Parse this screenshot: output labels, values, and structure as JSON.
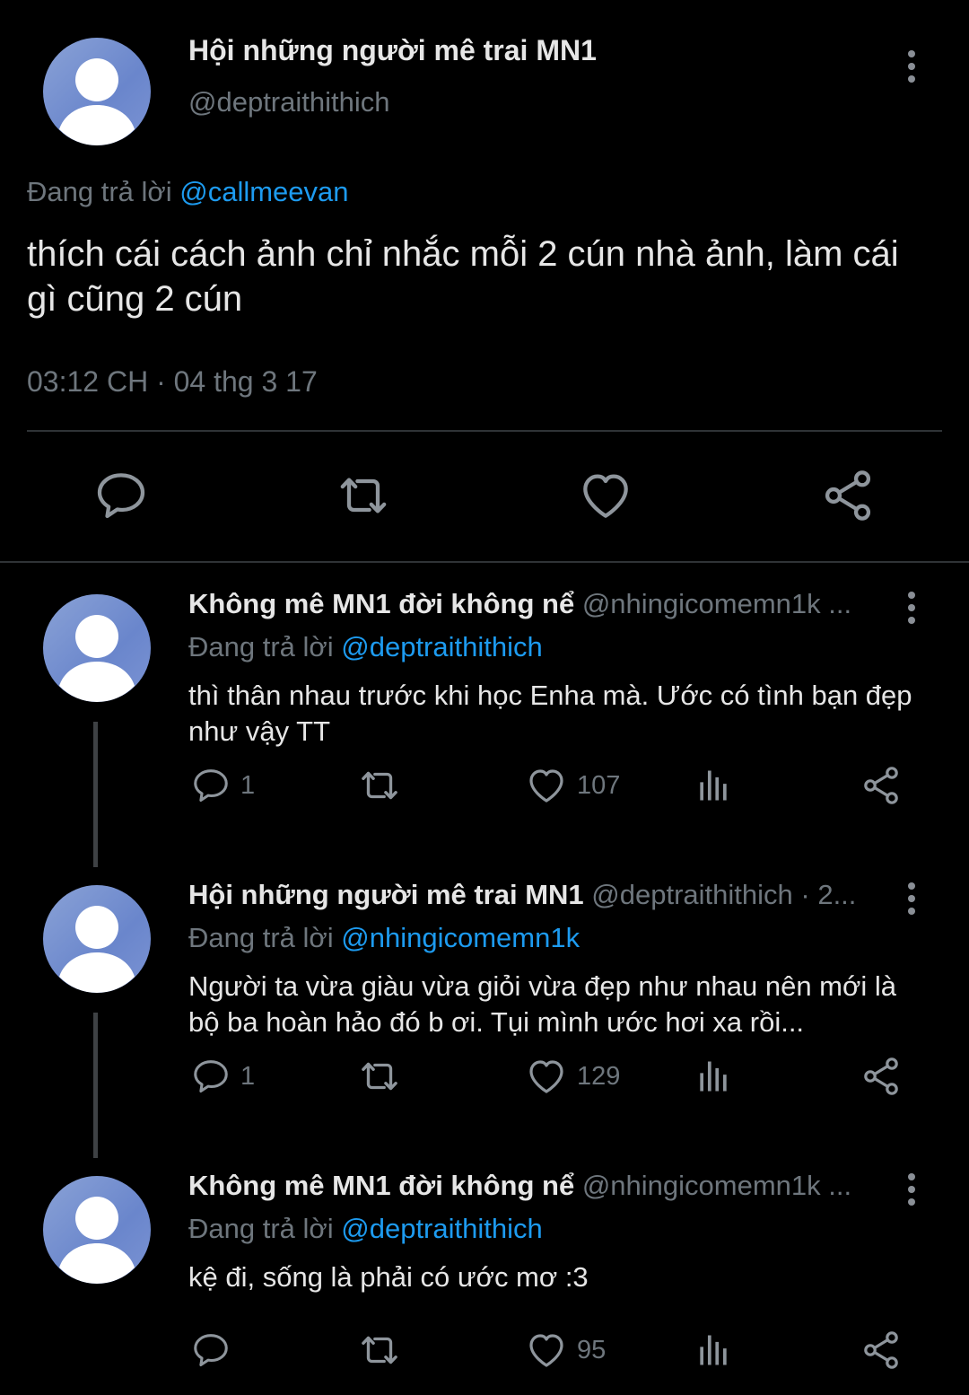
{
  "main_tweet": {
    "author_name": "Hội những người mê trai MN1",
    "author_handle": "@deptraithithich",
    "reply_prefix": "Đang trả lời",
    "reply_to": "@callmeevan",
    "text": "thích cái cách ảnh chỉ nhắc mỗi 2 cún nhà ảnh, làm cái gì cũng 2 cún",
    "timestamp": "03:12 CH · 04 thg 3 17",
    "actions": [
      "reply-icon",
      "retweet-icon",
      "like-icon",
      "share-icon"
    ]
  },
  "replies": [
    {
      "author_name": "Không mê MN1 đời không nể",
      "author_handle": "@nhingicomemn1k ...",
      "reply_prefix": "Đang trả lời",
      "reply_to": "@deptraithithich",
      "text": "thì thân nhau trước khi học Enha mà. Ước có tình bạn đẹp như vậy TT",
      "reply_count": "1",
      "like_count": "107"
    },
    {
      "author_name": "Hội những người mê trai MN1",
      "author_handle": "@deptraithithich · 2...",
      "reply_prefix": "Đang trả lời",
      "reply_to": "@nhingicomemn1k",
      "text": "Người ta vừa giàu vừa giỏi vừa đẹp như nhau nên mới là bộ ba hoàn hảo đó b ơi. Tụi mình ước hơi xa rồi...",
      "reply_count": "1",
      "like_count": "129"
    },
    {
      "author_name": "Không mê MN1 đời không nể",
      "author_handle": "@nhingicomemn1k ...",
      "reply_prefix": "Đang trả lời",
      "reply_to": "@deptraithithich",
      "text": "kệ đi, sống là phải có ước mơ :3",
      "reply_count": "",
      "like_count": "95"
    }
  ],
  "colors": {
    "background": "#000000",
    "text": "#e6e6e6",
    "muted": "#6e767d",
    "mention": "#1d9bf0",
    "avatar": "#7b93d3"
  }
}
